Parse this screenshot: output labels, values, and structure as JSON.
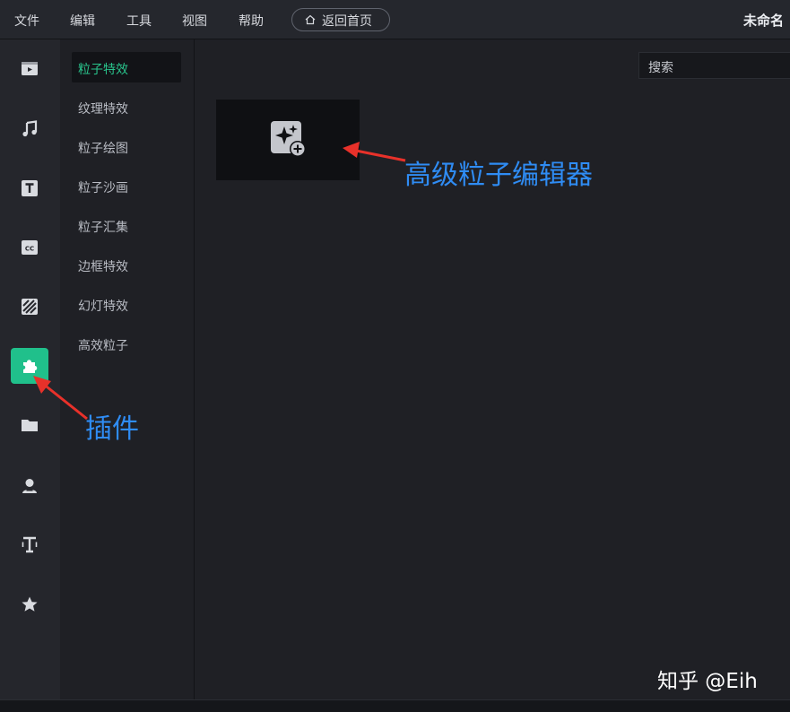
{
  "menubar": {
    "items": [
      "文件",
      "编辑",
      "工具",
      "视图",
      "帮助"
    ],
    "home_button": "返回首页",
    "doc_title": "未命名"
  },
  "sidebar": {
    "icons": [
      {
        "name": "media-icon"
      },
      {
        "name": "music-icon"
      },
      {
        "name": "text-icon"
      },
      {
        "name": "subtitle-cc-icon"
      },
      {
        "name": "filter-stripes-icon"
      },
      {
        "name": "plugin-puzzle-icon",
        "active": true
      },
      {
        "name": "folder-icon"
      },
      {
        "name": "person-icon"
      },
      {
        "name": "text-tool-icon"
      },
      {
        "name": "star-icon"
      }
    ]
  },
  "categories": {
    "items": [
      "粒子特效",
      "纹理特效",
      "粒子绘图",
      "粒子沙画",
      "粒子汇集",
      "边框特效",
      "幻灯特效",
      "高效粒子"
    ],
    "active_index": 0
  },
  "search": {
    "placeholder": "搜索"
  },
  "annotations": {
    "editor": "高级粒子编辑器",
    "plugin": "插件",
    "arrow_color": "#e8312a",
    "text_color": "#2f8cf4"
  },
  "watermark": "知乎 @Eih",
  "colors": {
    "accent": "#20c08b",
    "active_text": "#29c48c"
  }
}
